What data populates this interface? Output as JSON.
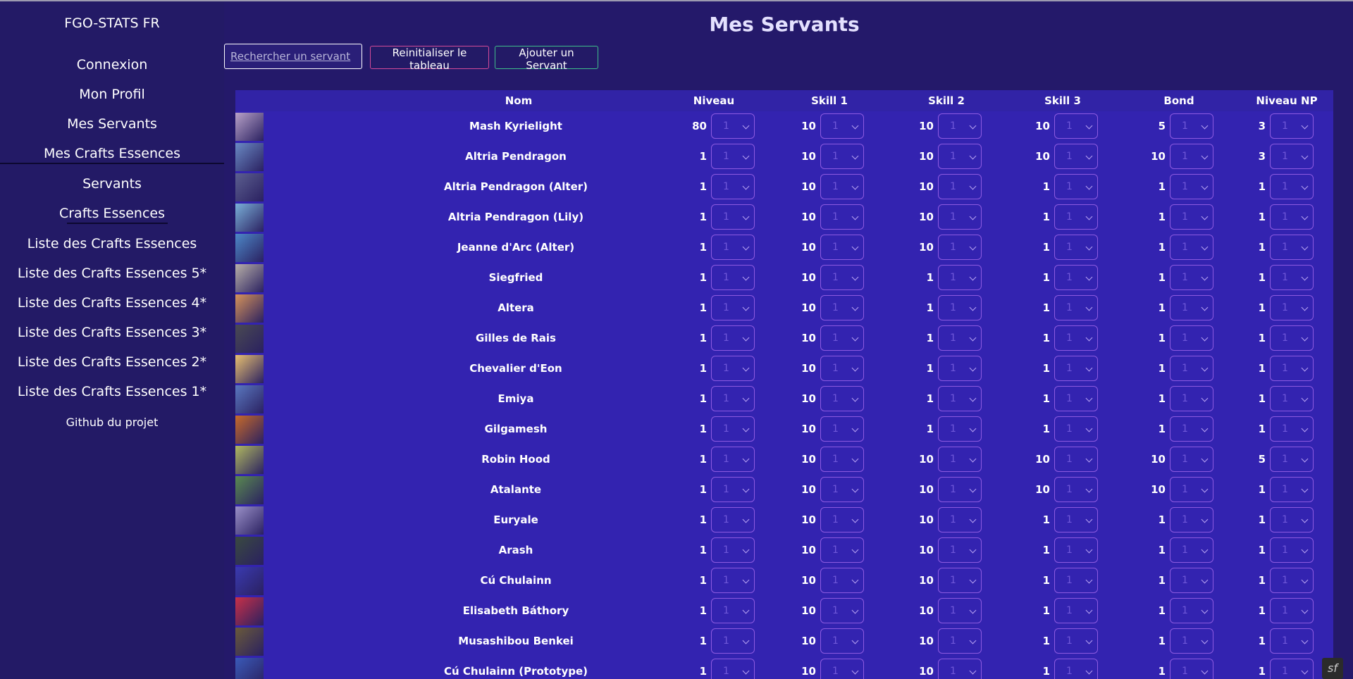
{
  "sidebar": {
    "brand": "FGO-STATS FR",
    "items": [
      {
        "label": "Connexion"
      },
      {
        "label": "Mon Profil"
      },
      {
        "label": "Mes Servants"
      },
      {
        "label": "Mes Crafts Essences"
      },
      {
        "label": "Servants"
      },
      {
        "label": "Crafts Essences"
      },
      {
        "label": "Liste des Crafts Essences"
      },
      {
        "label": "Liste des Crafts Essences 5*"
      },
      {
        "label": "Liste des Crafts Essences 4*"
      },
      {
        "label": "Liste des Crafts Essences 3*"
      },
      {
        "label": "Liste des Crafts Essences 2*"
      },
      {
        "label": "Liste des Crafts Essences 1*"
      },
      {
        "label": "Github du projet"
      }
    ]
  },
  "page": {
    "title": "Mes Servants",
    "search_placeholder": "Rechercher un servant",
    "reset_label": "Reinitialiser le tableau",
    "add_label": "Ajouter un Servant"
  },
  "table": {
    "columns": [
      "Nom",
      "Niveau",
      "Skill 1",
      "Skill 2",
      "Skill 3",
      "Bond",
      "Niveau NP"
    ],
    "select_default": "1",
    "rows": [
      {
        "name": "Mash Kyrielight",
        "level": "80",
        "skill1": "10",
        "skill2": "10",
        "skill3": "10",
        "bond": "5",
        "np": "3",
        "color": "#b8a2c8"
      },
      {
        "name": "Altria Pendragon",
        "level": "1",
        "skill1": "10",
        "skill2": "10",
        "skill3": "10",
        "bond": "10",
        "np": "3",
        "color": "#6a8ac4"
      },
      {
        "name": "Altria Pendragon (Alter)",
        "level": "1",
        "skill1": "10",
        "skill2": "10",
        "skill3": "1",
        "bond": "1",
        "np": "1",
        "color": "#5c5f90"
      },
      {
        "name": "Altria Pendragon (Lily)",
        "level": "1",
        "skill1": "10",
        "skill2": "10",
        "skill3": "1",
        "bond": "1",
        "np": "1",
        "color": "#7ab0d8"
      },
      {
        "name": "Jeanne d'Arc (Alter)",
        "level": "1",
        "skill1": "10",
        "skill2": "10",
        "skill3": "1",
        "bond": "1",
        "np": "1",
        "color": "#4d88c8"
      },
      {
        "name": "Siegfried",
        "level": "1",
        "skill1": "10",
        "skill2": "1",
        "skill3": "1",
        "bond": "1",
        "np": "1",
        "color": "#b8b0a8"
      },
      {
        "name": "Altera",
        "level": "1",
        "skill1": "10",
        "skill2": "1",
        "skill3": "1",
        "bond": "1",
        "np": "1",
        "color": "#d6935a"
      },
      {
        "name": "Gilles de Rais",
        "level": "1",
        "skill1": "10",
        "skill2": "1",
        "skill3": "1",
        "bond": "1",
        "np": "1",
        "color": "#4a4a52"
      },
      {
        "name": "Chevalier d'Eon",
        "level": "1",
        "skill1": "10",
        "skill2": "1",
        "skill3": "1",
        "bond": "1",
        "np": "1",
        "color": "#e8c070"
      },
      {
        "name": "Emiya",
        "level": "1",
        "skill1": "10",
        "skill2": "1",
        "skill3": "1",
        "bond": "1",
        "np": "1",
        "color": "#5a78c0"
      },
      {
        "name": "Gilgamesh",
        "level": "1",
        "skill1": "10",
        "skill2": "1",
        "skill3": "1",
        "bond": "1",
        "np": "1",
        "color": "#c86a2a"
      },
      {
        "name": "Robin Hood",
        "level": "1",
        "skill1": "10",
        "skill2": "10",
        "skill3": "10",
        "bond": "10",
        "np": "5",
        "color": "#b0b860"
      },
      {
        "name": "Atalante",
        "level": "1",
        "skill1": "10",
        "skill2": "10",
        "skill3": "10",
        "bond": "10",
        "np": "1",
        "color": "#5a8a50"
      },
      {
        "name": "Euryale",
        "level": "1",
        "skill1": "10",
        "skill2": "10",
        "skill3": "1",
        "bond": "1",
        "np": "1",
        "color": "#9a90c8"
      },
      {
        "name": "Arash",
        "level": "1",
        "skill1": "10",
        "skill2": "10",
        "skill3": "1",
        "bond": "1",
        "np": "1",
        "color": "#3a4a40"
      },
      {
        "name": "Cú Chulainn",
        "level": "1",
        "skill1": "10",
        "skill2": "10",
        "skill3": "1",
        "bond": "1",
        "np": "1",
        "color": "#3a3ab0"
      },
      {
        "name": "Elisabeth Báthory",
        "level": "1",
        "skill1": "10",
        "skill2": "10",
        "skill3": "1",
        "bond": "1",
        "np": "1",
        "color": "#c83048"
      },
      {
        "name": "Musashibou Benkei",
        "level": "1",
        "skill1": "10",
        "skill2": "10",
        "skill3": "1",
        "bond": "1",
        "np": "1",
        "color": "#6a5a3a"
      },
      {
        "name": "Cú Chulainn (Prototype)",
        "level": "1",
        "skill1": "10",
        "skill2": "10",
        "skill3": "1",
        "bond": "1",
        "np": "1",
        "color": "#3a5ab8"
      }
    ]
  },
  "debug_badge": "sf"
}
